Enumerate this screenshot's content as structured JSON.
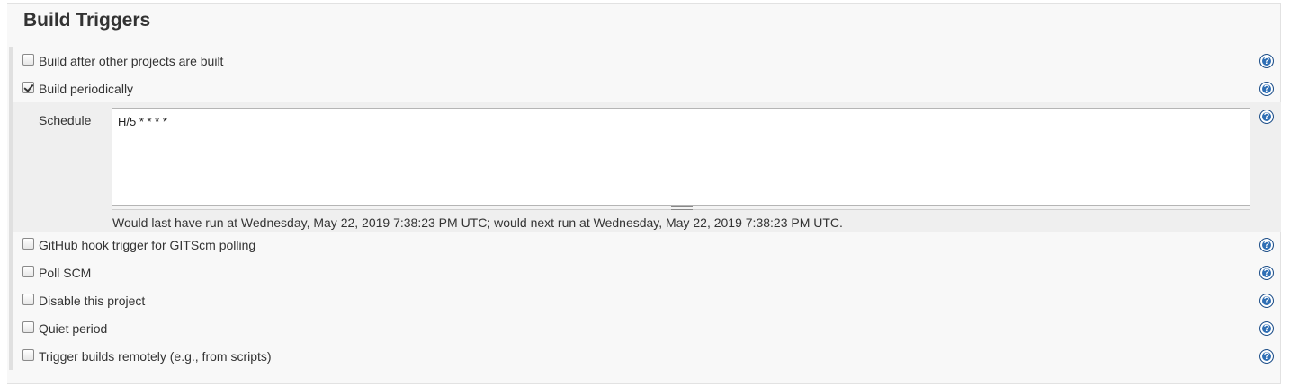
{
  "section": {
    "title": "Build Triggers"
  },
  "triggers": [
    {
      "label": "Build after other projects are built",
      "checked": false
    },
    {
      "label": "Build periodically",
      "checked": true
    },
    {
      "label": "GitHub hook trigger for GITScm polling",
      "checked": false
    },
    {
      "label": "Poll SCM",
      "checked": false
    },
    {
      "label": "Disable this project",
      "checked": false
    },
    {
      "label": "Quiet period",
      "checked": false
    },
    {
      "label": "Trigger builds remotely (e.g., from scripts)",
      "checked": false
    }
  ],
  "schedule": {
    "label": "Schedule",
    "value": "H/5 * * * *",
    "note": "Would last have run at Wednesday, May 22, 2019 7:38:23 PM UTC; would next run at Wednesday, May 22, 2019 7:38:23 PM UTC."
  },
  "help_glyph": "?",
  "icons": {
    "help": "help-icon"
  },
  "colors": {
    "help_icon": "#2f6fb5",
    "panel_bg": "#f8f8f8",
    "schedule_bg": "#efefef"
  }
}
